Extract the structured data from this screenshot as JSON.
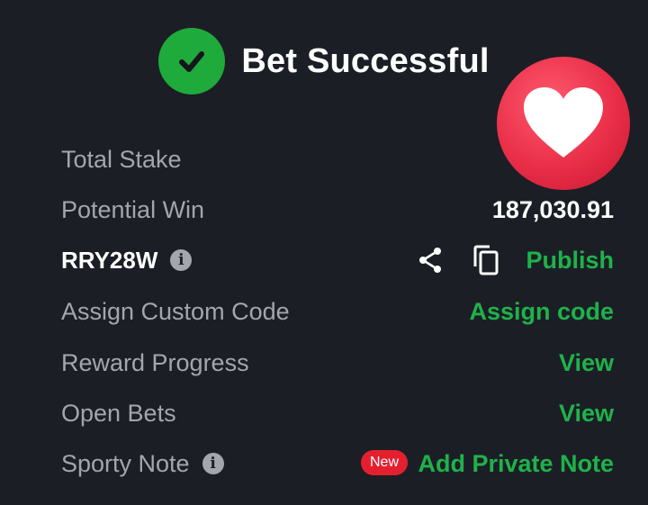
{
  "header": {
    "title": "Bet Successful",
    "status_icon": "check-circle-icon",
    "accent": "#1faa3c"
  },
  "reaction": {
    "icon": "heart-icon",
    "color": "#e92e48"
  },
  "rows": {
    "total_stake": {
      "label": "Total Stake",
      "value": ""
    },
    "potential_win": {
      "label": "Potential Win",
      "value": "187,030.91"
    },
    "booking": {
      "code": "RRY28W",
      "info_icon": "info-icon",
      "share_icon": "share-icon",
      "copy_icon": "copy-icon",
      "publish_label": "Publish"
    },
    "custom_code": {
      "label": "Assign Custom Code",
      "action": "Assign code"
    },
    "reward_progress": {
      "label": "Reward Progress",
      "action": "View"
    },
    "open_bets": {
      "label": "Open Bets",
      "action": "View"
    },
    "sporty_note": {
      "label": "Sporty Note",
      "info_icon": "info-icon",
      "badge": "New",
      "action": "Add Private Note"
    }
  },
  "colors": {
    "background": "#1c1e26",
    "link": "#1fb24a",
    "muted_text": "#a3a6ad",
    "badge": "#e4202f"
  }
}
